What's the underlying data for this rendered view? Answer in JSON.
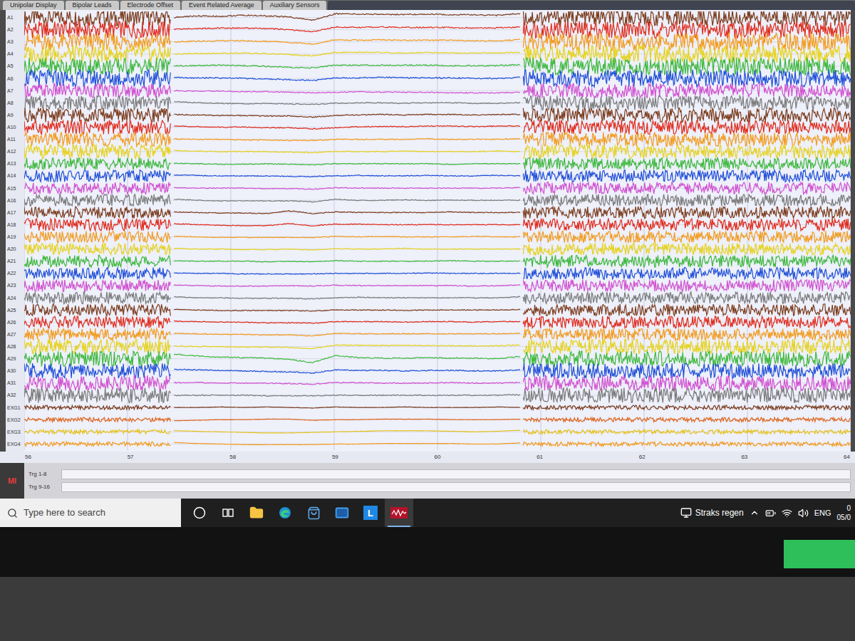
{
  "tabs": [
    {
      "label": "Unipolar Display",
      "selected": false
    },
    {
      "label": "Bipolar Leads",
      "selected": false
    },
    {
      "label": "Electrode Offset",
      "selected": false
    },
    {
      "label": "Event Related Average",
      "selected": false
    },
    {
      "label": "Auxiliary Sensors",
      "selected": false
    }
  ],
  "chart": {
    "x_ticks": [
      "56",
      "57",
      "58",
      "59",
      "60",
      "61",
      "62",
      "63",
      "64"
    ],
    "clean_segment": {
      "from": 57.45,
      "to": 60.8
    },
    "noisy_segments": [
      {
        "from": 56.0,
        "to": 57.42
      },
      {
        "from": 60.83,
        "to": 64.0
      }
    ],
    "channels": [
      {
        "name": "A1",
        "color": "#7b3b1c",
        "noise": 16,
        "values": [
          0,
          3,
          2,
          4,
          3,
          1,
          -5,
          7,
          6,
          6,
          5,
          6,
          5,
          5,
          4,
          7
        ]
      },
      {
        "name": "A2",
        "color": "#e02a1a",
        "noise": 16,
        "values": [
          1,
          2,
          3,
          3,
          2,
          0,
          -4,
          5,
          4,
          5,
          4,
          4,
          4,
          3,
          3,
          5
        ]
      },
      {
        "name": "A3",
        "color": "#f39a1a",
        "noise": 16,
        "values": [
          0,
          1,
          2,
          2,
          1,
          -1,
          -4,
          4,
          3,
          4,
          3,
          3,
          3,
          2,
          2,
          4
        ]
      },
      {
        "name": "A4",
        "color": "#e6d21a",
        "noise": 16,
        "values": [
          0,
          1,
          1,
          2,
          1,
          -1,
          -3,
          3,
          3,
          3,
          2,
          3,
          2,
          2,
          2,
          3
        ]
      },
      {
        "name": "A5",
        "color": "#3cb83c",
        "noise": 16,
        "values": [
          1,
          1,
          2,
          1,
          0,
          -2,
          -3,
          2,
          2,
          2,
          2,
          2,
          1,
          1,
          1,
          3
        ]
      },
      {
        "name": "A6",
        "color": "#1f4fd8",
        "noise": 16,
        "values": [
          2,
          1,
          1,
          0,
          -1,
          -2,
          -4,
          1,
          1,
          2,
          1,
          1,
          1,
          0,
          0,
          2
        ]
      },
      {
        "name": "A7",
        "color": "#d14fd0",
        "noise": 13,
        "values": [
          0,
          -1,
          -1,
          -2,
          -2,
          -3,
          -4,
          -3,
          -2,
          -3,
          -3,
          -3,
          -4,
          -4,
          -4,
          -3
        ]
      },
      {
        "name": "A8",
        "color": "#7a7a7a",
        "noise": 13,
        "values": [
          2,
          0,
          -1,
          -2,
          -1,
          -2,
          -3,
          -1,
          0,
          0,
          -1,
          0,
          0,
          -1,
          -1,
          0
        ]
      },
      {
        "name": "A9",
        "color": "#7b3b1c",
        "noise": 13,
        "values": [
          1,
          0,
          -1,
          -1,
          -2,
          -2,
          -4,
          -1,
          0,
          1,
          0,
          1,
          1,
          0,
          1,
          1
        ]
      },
      {
        "name": "A10",
        "color": "#e02a1a",
        "noise": 13,
        "values": [
          2,
          1,
          0,
          0,
          -1,
          -1,
          -3,
          -1,
          1,
          1,
          1,
          2,
          2,
          1,
          2,
          2
        ]
      },
      {
        "name": "A11",
        "color": "#f39a1a",
        "noise": 13,
        "values": [
          1,
          0,
          0,
          -1,
          -1,
          -2,
          -2,
          0,
          0,
          0,
          0,
          1,
          0,
          0,
          0,
          1
        ]
      },
      {
        "name": "A12",
        "color": "#e6d21a",
        "noise": 13,
        "values": [
          2,
          1,
          0,
          0,
          0,
          -1,
          -2,
          0,
          0,
          0,
          1,
          0,
          0,
          0,
          1,
          0
        ]
      },
      {
        "name": "A13",
        "color": "#3cb83c",
        "noise": 11,
        "values": [
          1,
          0,
          -1,
          -1,
          0,
          -1,
          -2,
          0,
          0,
          0,
          0,
          0,
          -1,
          0,
          0,
          0
        ]
      },
      {
        "name": "A14",
        "color": "#1f4fd8",
        "noise": 11,
        "values": [
          2,
          1,
          0,
          0,
          0,
          -1,
          -1,
          0,
          1,
          0,
          0,
          1,
          0,
          0,
          1,
          0
        ]
      },
      {
        "name": "A15",
        "color": "#d14fd0",
        "noise": 11,
        "values": [
          1,
          0,
          0,
          0,
          -1,
          -1,
          -2,
          1,
          0,
          0,
          0,
          0,
          0,
          0,
          0,
          1
        ]
      },
      {
        "name": "A16",
        "color": "#7a7a7a",
        "noise": 11,
        "values": [
          2,
          0,
          -1,
          -1,
          -1,
          -1,
          -3,
          2,
          0,
          0,
          1,
          0,
          0,
          0,
          0,
          0
        ]
      },
      {
        "name": "A17",
        "color": "#7b3b1c",
        "noise": 11,
        "values": [
          1,
          0,
          -1,
          -1,
          -2,
          3,
          -2,
          1,
          0,
          0,
          0,
          0,
          1,
          0,
          0,
          0
        ]
      },
      {
        "name": "A18",
        "color": "#e02a1a",
        "noise": 11,
        "values": [
          2,
          0,
          -1,
          -2,
          -2,
          2,
          -2,
          1,
          1,
          0,
          0,
          0,
          0,
          0,
          0,
          0
        ]
      },
      {
        "name": "A19",
        "color": "#f39a1a",
        "noise": 11,
        "values": [
          1,
          0,
          -1,
          -1,
          -1,
          -1,
          -1,
          1,
          0,
          1,
          0,
          0,
          0,
          1,
          0,
          0
        ]
      },
      {
        "name": "A20",
        "color": "#e6d21a",
        "noise": 11,
        "values": [
          1,
          0,
          0,
          -1,
          -1,
          0,
          -2,
          1,
          0,
          0,
          1,
          0,
          0,
          0,
          0,
          0
        ]
      },
      {
        "name": "A21",
        "color": "#3cb83c",
        "noise": 11,
        "values": [
          1,
          0,
          0,
          0,
          -1,
          0,
          -1,
          1,
          0,
          0,
          0,
          0,
          1,
          0,
          0,
          0
        ]
      },
      {
        "name": "A22",
        "color": "#1f4fd8",
        "noise": 11,
        "values": [
          1,
          0,
          0,
          -1,
          -1,
          -1,
          -1,
          0,
          0,
          0,
          0,
          1,
          0,
          0,
          0,
          0
        ]
      },
      {
        "name": "A23",
        "color": "#d14fd0",
        "noise": 11,
        "values": [
          1,
          0,
          -1,
          -1,
          -1,
          0,
          -1,
          1,
          0,
          0,
          0,
          0,
          0,
          -1,
          0,
          1
        ]
      },
      {
        "name": "A24",
        "color": "#7a7a7a",
        "noise": 11,
        "values": [
          2,
          0,
          0,
          -1,
          -1,
          -1,
          -2,
          0,
          1,
          0,
          0,
          0,
          0,
          0,
          0,
          2
        ]
      },
      {
        "name": "A25",
        "color": "#7b3b1c",
        "noise": 11,
        "values": [
          1,
          0,
          -1,
          -1,
          -1,
          -1,
          -2,
          0,
          0,
          0,
          -1,
          0,
          0,
          0,
          0,
          1
        ]
      },
      {
        "name": "A26",
        "color": "#e02a1a",
        "noise": 11,
        "values": [
          2,
          1,
          0,
          0,
          -1,
          -1,
          -2,
          1,
          1,
          1,
          0,
          1,
          1,
          0,
          1,
          1
        ]
      },
      {
        "name": "A27",
        "color": "#f39a1a",
        "noise": 11,
        "values": [
          2,
          1,
          0,
          0,
          -1,
          -1,
          -3,
          2,
          1,
          1,
          1,
          1,
          1,
          1,
          1,
          2
        ]
      },
      {
        "name": "A28",
        "color": "#e6d21a",
        "noise": 14,
        "values": [
          1,
          0,
          0,
          -1,
          -1,
          -2,
          -4,
          3,
          2,
          2,
          2,
          2,
          1,
          1,
          1,
          3
        ]
      },
      {
        "name": "A29",
        "color": "#3cb83c",
        "noise": 14,
        "values": [
          8,
          5,
          3,
          2,
          1,
          -1,
          -7,
          6,
          2,
          1,
          1,
          2,
          1,
          1,
          0,
          4
        ]
      },
      {
        "name": "A30",
        "color": "#1f4fd8",
        "noise": 14,
        "values": [
          3,
          2,
          1,
          0,
          -1,
          -2,
          -4,
          2,
          1,
          1,
          0,
          1,
          1,
          0,
          0,
          2
        ]
      },
      {
        "name": "A31",
        "color": "#d14fd0",
        "noise": 14,
        "values": [
          1,
          1,
          0,
          0,
          0,
          -1,
          -2,
          1,
          1,
          0,
          0,
          0,
          1,
          0,
          0,
          1
        ]
      },
      {
        "name": "A32",
        "color": "#7a7a7a",
        "noise": 14,
        "values": [
          0,
          0,
          0,
          0,
          -1,
          -1,
          -1,
          0,
          0,
          0,
          0,
          0,
          0,
          0,
          0,
          1
        ]
      },
      {
        "name": "EXG1",
        "color": "#7b3b1c",
        "noise": 4,
        "values": [
          0,
          0,
          1,
          0,
          1,
          0,
          -1,
          1,
          0,
          0,
          1,
          0,
          0,
          0,
          1,
          0
        ]
      },
      {
        "name": "EXG2",
        "color": "#e0641a",
        "noise": 4,
        "values": [
          -2,
          -1,
          0,
          0,
          1,
          1,
          -1,
          0,
          0,
          1,
          1,
          1,
          0,
          0,
          0,
          1
        ]
      },
      {
        "name": "EXG3",
        "color": "#e6c21a",
        "noise": 4,
        "values": [
          2,
          1,
          0,
          -1,
          -2,
          -2,
          -1,
          0,
          1,
          2,
          2,
          2,
          1,
          0,
          1,
          3
        ]
      },
      {
        "name": "EXG4",
        "color": "#f39a1a",
        "noise": 4,
        "values": [
          3,
          1,
          0,
          -1,
          -1,
          -1,
          -1,
          0,
          0,
          1,
          1,
          1,
          1,
          0,
          0,
          2
        ]
      }
    ]
  },
  "triggers": [
    {
      "label": "Trg 1-8"
    },
    {
      "label": "Trg 9-16"
    }
  ],
  "logo": "MI",
  "taskbar": {
    "search": {
      "placeholder": "Type here to search"
    },
    "apps": [
      {
        "kind": "cortana",
        "active": false
      },
      {
        "kind": "taskview",
        "active": false
      },
      {
        "kind": "explorer",
        "active": false
      },
      {
        "kind": "edge",
        "active": false
      },
      {
        "kind": "store",
        "active": false
      },
      {
        "kind": "mail",
        "active": false
      },
      {
        "kind": "letter",
        "label": "L",
        "active": false
      },
      {
        "kind": "biosemi",
        "active": true
      }
    ],
    "weather": "Straks regen",
    "language": "ENG",
    "clock": {
      "time": "0",
      "date": "05/0"
    }
  }
}
